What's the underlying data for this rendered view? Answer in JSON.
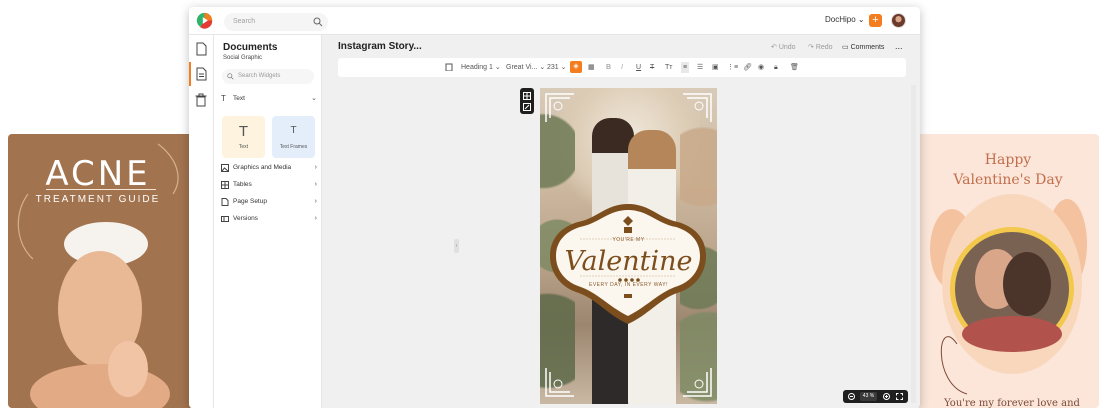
{
  "left_card": {
    "title": "ACNE",
    "subtitle": "TREATMENT GUIDE"
  },
  "right_card": {
    "title_line1": "Happy",
    "title_line2": "Valentine's Day",
    "footer": "You're my forever love and"
  },
  "topbar": {
    "search_placeholder": "Search",
    "brand_menu": "DocHipo",
    "plus_label": "+"
  },
  "side_panel": {
    "title": "Documents",
    "subtitle": "Social Graphic",
    "widget_search_placeholder": "Search Widgets",
    "text_section": "Text",
    "tiles": [
      {
        "label": "Text",
        "glyph": "T"
      },
      {
        "label": "Text Frames",
        "glyph": "T"
      }
    ],
    "sections": [
      "Graphics and Media",
      "Tables",
      "Page Setup",
      "Versions"
    ]
  },
  "document": {
    "title": "Instagram Story...",
    "undo": "Undo",
    "redo": "Redo",
    "comments": "Comments",
    "more": "..."
  },
  "toolbar": {
    "style": "Heading 1",
    "font": "Great Vi...",
    "size": "231"
  },
  "canvas": {
    "badge_top": "YOU'RE MY",
    "badge_main": "Valentine",
    "badge_sub": "EVERY DAY, IN EVERY WAY!"
  },
  "zoom": {
    "value": "43 %"
  },
  "colors": {
    "accent": "#f47d1f",
    "brown": "#7d4e1d",
    "acne_card": "#a2734f",
    "valentine_card": "#fbe6d9"
  }
}
